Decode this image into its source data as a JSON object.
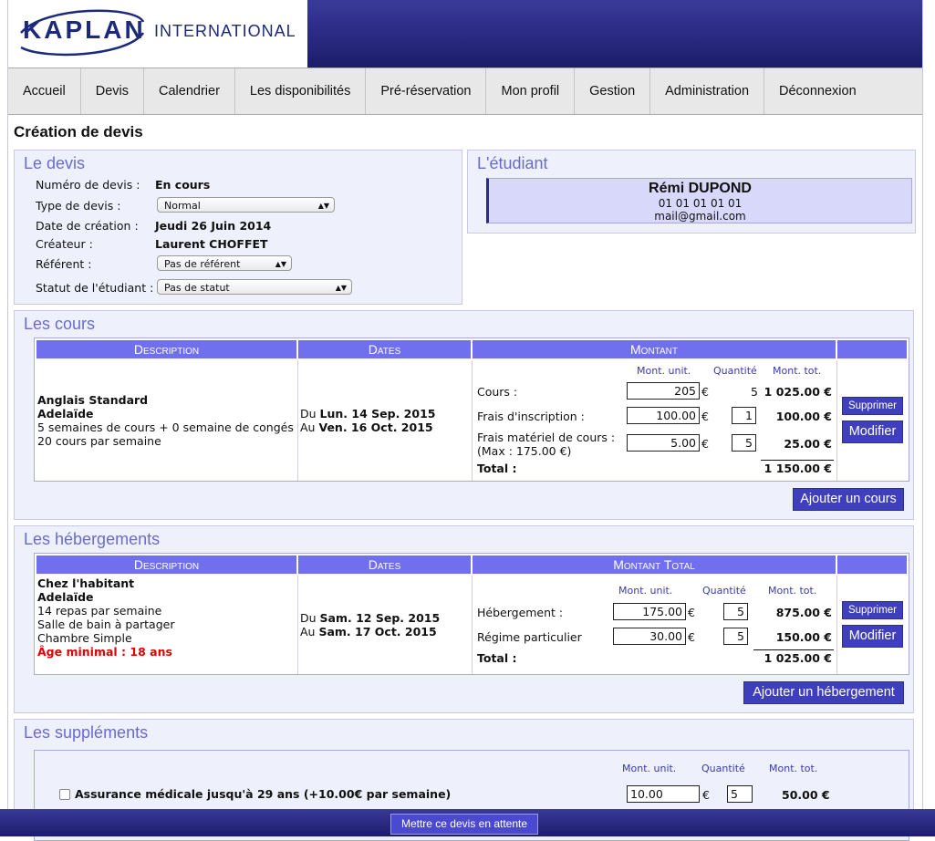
{
  "brand": {
    "name": "KAPLAN",
    "tagline": "INTERNATIONAL"
  },
  "nav": [
    "Accueil",
    "Devis",
    "Calendrier",
    "Les disponibilités",
    "Pré-réservation",
    "Mon profil",
    "Gestion",
    "Administration",
    "Déconnexion"
  ],
  "page_title": "Création de devis",
  "devis": {
    "title": "Le devis",
    "numero_label": "Numéro de devis :",
    "numero_value": "En cours",
    "type_label": "Type de devis :",
    "type_value": "Normal",
    "date_label": "Date de création :",
    "date_value": "Jeudi 26 Juin 2014",
    "createur_label": "Créateur :",
    "createur_value": "Laurent CHOFFET",
    "referent_label": "Référent :",
    "referent_value": "Pas de référent",
    "statut_label": "Statut de l'étudiant :",
    "statut_value": "Pas de statut"
  },
  "etudiant": {
    "title": "L'étudiant",
    "name": "Rémi DUPOND",
    "phone": "01 01 01 01 01",
    "email": "mail@gmail.com"
  },
  "cours": {
    "title": "Les cours",
    "headers": [
      "Description",
      "Dates",
      "Montant"
    ],
    "col_unit": "Mont. unit.",
    "col_qty": "Quantité",
    "col_tot": "Mont. tot.",
    "desc_title": "Anglais Standard",
    "desc_city": "Adelaïde",
    "desc_line1": "5 semaines de cours + 0 semaine de congés",
    "desc_line2": "20 cours par semaine",
    "date_from_prefix": "Du",
    "date_from": "Lun. 14 Sep. 2015",
    "date_to_prefix": "Au",
    "date_to": "Ven. 16 Oct. 2015",
    "rows": [
      {
        "label": "Cours :",
        "unit": "205",
        "qty": "5",
        "total": "1 025.00 €"
      },
      {
        "label": "Frais d'inscription :",
        "unit": "100.00",
        "qty": "1",
        "total": "100.00 €"
      },
      {
        "label": "Frais matériel de cours :",
        "label2": "(Max : 175.00 €)",
        "unit": "5.00",
        "qty": "5",
        "total": "25.00 €"
      }
    ],
    "total_label": "Total :",
    "total_value": "1 150.00 €",
    "currency": "€",
    "delete_btn": "Supprimer",
    "edit_btn": "Modifier",
    "add_btn": "Ajouter un cours"
  },
  "hebergements": {
    "title": "Les hébergements",
    "headers": [
      "Description",
      "Dates",
      "Montant Total"
    ],
    "col_unit": "Mont. unit.",
    "col_qty": "Quantité",
    "col_tot": "Mont. tot.",
    "desc_title": "Chez l'habitant",
    "desc_city": "Adelaïde",
    "desc_line1": "14 repas par semaine",
    "desc_line2": "Salle de bain à partager",
    "desc_line3": "Chambre Simple",
    "age_min": "Âge minimal : 18 ans",
    "date_from_prefix": "Du",
    "date_from": "Sam. 12 Sep. 2015",
    "date_to_prefix": "Au",
    "date_to": "Sam. 17 Oct. 2015",
    "rows": [
      {
        "label": "Hébergement :",
        "unit": "175.00",
        "qty": "5",
        "total": "875.00 €"
      },
      {
        "label": "Régime particulier",
        "unit": "30.00",
        "qty": "5",
        "total": "150.00 €"
      }
    ],
    "total_label": "Total :",
    "total_value": "1 025.00 €",
    "currency": "€",
    "delete_btn": "Supprimer",
    "edit_btn": "Modifier",
    "add_btn": "Ajouter un hébergement"
  },
  "supplements": {
    "title": "Les suppléments",
    "col_unit": "Mont. unit.",
    "col_qty": "Quantité",
    "col_tot": "Mont. tot.",
    "item_label": "Assurance médicale jusqu'à 29 ans (+10.00€ par semaine)",
    "item_unit": "10.00",
    "item_currency": "€",
    "item_qty": "5",
    "item_total": "50.00 €"
  },
  "footer_btn": "Mettre ce devis en attente"
}
